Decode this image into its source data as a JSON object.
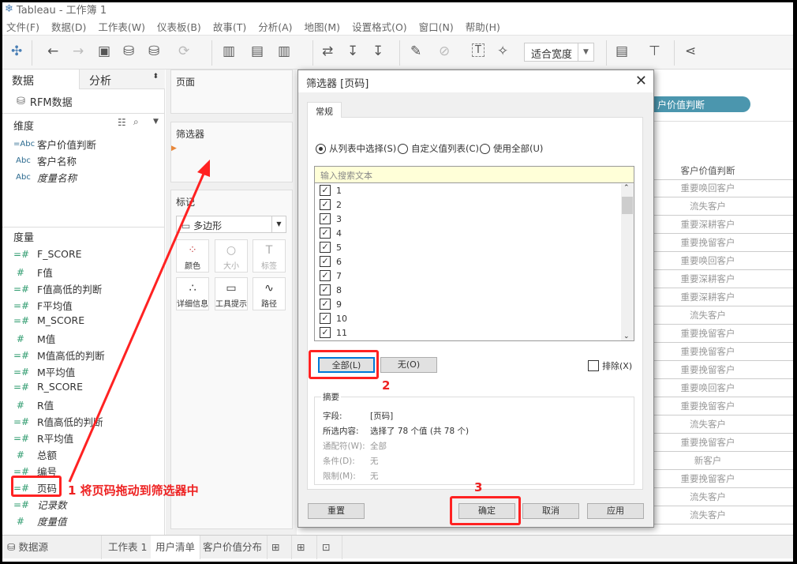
{
  "window": {
    "title": "Tableau - 工作簿 1"
  },
  "menu": [
    "文件(F)",
    "数据(D)",
    "工作表(W)",
    "仪表板(B)",
    "故事(T)",
    "分析(A)",
    "地图(M)",
    "设置格式(O)",
    "窗口(N)",
    "帮助(H)"
  ],
  "toolbar": {
    "fit": "适合宽度"
  },
  "left": {
    "tab_data": "数据",
    "tab_analysis": "分析",
    "datasource": "RFM数据",
    "dimensions_header": "维度",
    "dimensions": [
      {
        "label": "客户价值判断",
        "italic": false
      },
      {
        "label": "客户名称",
        "italic": false
      },
      {
        "label": "度量名称",
        "italic": true
      }
    ],
    "measures_header": "度量",
    "measures": [
      {
        "label": "F_SCORE"
      },
      {
        "label": "F值"
      },
      {
        "label": "F值高低的判断"
      },
      {
        "label": "F平均值"
      },
      {
        "label": "M_SCORE"
      },
      {
        "label": "M值"
      },
      {
        "label": "M值高低的判断"
      },
      {
        "label": "M平均值"
      },
      {
        "label": "R_SCORE"
      },
      {
        "label": "R值"
      },
      {
        "label": "R值高低的判断"
      },
      {
        "label": "R平均值"
      },
      {
        "label": "总额"
      },
      {
        "label": "编号"
      },
      {
        "label": "页码"
      },
      {
        "label": "记录数"
      },
      {
        "label": "度量值"
      }
    ]
  },
  "cards": {
    "pages": "页面",
    "filters": "筛选器",
    "marks": "标记",
    "mark_type": "多边形",
    "buttons": [
      "颜色",
      "大小",
      "标签",
      "详细信息",
      "工具提示",
      "路径"
    ]
  },
  "view": {
    "pill": "户价值判断",
    "column_header": "客户价值判断",
    "rows": [
      "重要唤回客户",
      "流失客户",
      "重要深耕客户",
      "重要挽留客户",
      "重要唤回客户",
      "重要深耕客户",
      "重要深耕客户",
      "流失客户",
      "重要挽留客户",
      "重要挽留客户",
      "重要挽留客户",
      "重要唤回客户",
      "重要挽留客户",
      "流失客户",
      "重要挽留客户",
      "新客户",
      "重要挽留客户",
      "流失客户",
      "流失客户"
    ]
  },
  "dialog": {
    "title": "筛选器 [页码]",
    "tab": "常规",
    "radios": [
      {
        "label": "从列表中选择(S)",
        "selected": true
      },
      {
        "label": "自定义值列表(C)",
        "selected": false
      },
      {
        "label": "使用全部(U)",
        "selected": false
      }
    ],
    "search_placeholder": "输入搜索文本",
    "items": [
      "1",
      "2",
      "3",
      "4",
      "5",
      "6",
      "7",
      "8",
      "9",
      "10",
      "11"
    ],
    "all_button": "全部(L)",
    "none_button": "无(O)",
    "exclude_label": "排除(X)",
    "exclude_checked": false,
    "summary": {
      "title": "摘要",
      "field_label": "字段:",
      "field_value": "[页码]",
      "selection_label": "所选内容:",
      "selection_value": "选择了 78 个值 (共 78 个)",
      "wildcard_label": "通配符(W):",
      "wildcard_value": "全部",
      "condition_label": "条件(D):",
      "condition_value": "无",
      "limit_label": "限制(M):",
      "limit_value": "无"
    },
    "reset": "重置",
    "ok": "确定",
    "cancel": "取消",
    "apply": "应用"
  },
  "annotations": {
    "step1": "1 将页码拖动到筛选器中",
    "step2": "2",
    "step3": "3",
    "color": "#ee2222"
  },
  "bottom": {
    "datasource": "数据源",
    "sheets": [
      "工作表 1",
      "用户清单",
      "客户价值分布"
    ],
    "active_sheet": "用户清单"
  }
}
